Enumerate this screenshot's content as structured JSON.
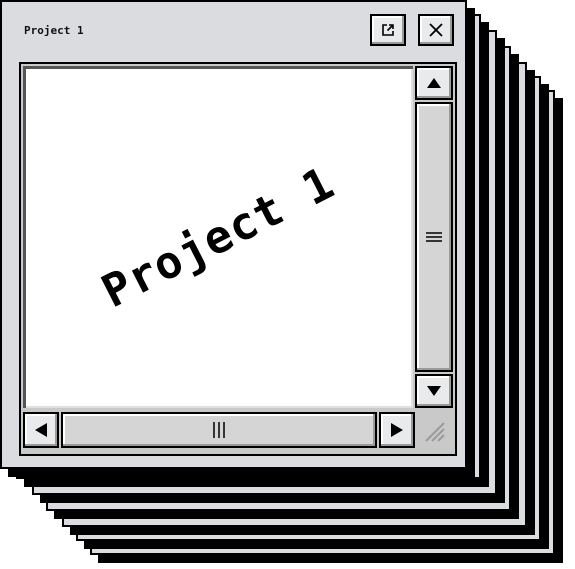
{
  "window": {
    "title": "Project 1",
    "content_text": "Project 1"
  },
  "titlebar": {
    "popout_icon": "external-link-icon",
    "close_icon": "close-icon"
  },
  "scrollbar": {
    "up_icon": "arrow-up-icon",
    "down_icon": "arrow-down-icon",
    "left_icon": "arrow-left-icon",
    "right_icon": "arrow-right-icon",
    "grip_icon": "resize-grip-icon"
  },
  "colors": {
    "window_bg": "#dadcdf",
    "border": "#000000",
    "canvas_bg": "#ffffff"
  },
  "stacked_windows": 6
}
